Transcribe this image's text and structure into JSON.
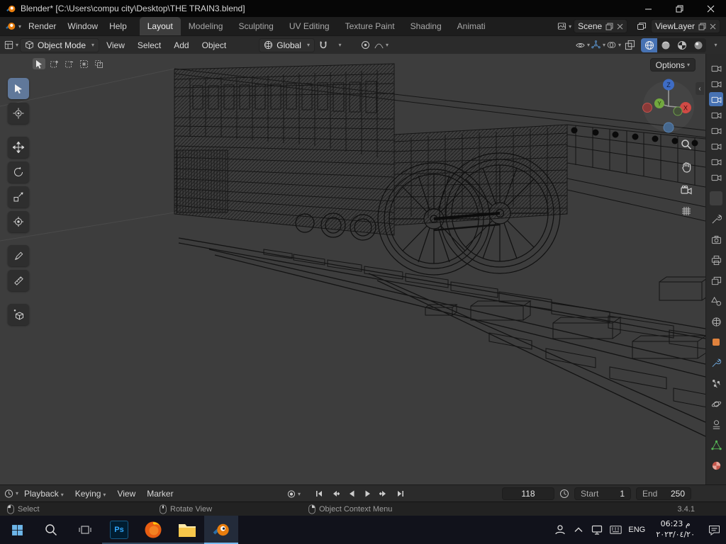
{
  "window": {
    "title": "Blender* [C:\\Users\\compu city\\Desktop\\THE TRAIN3.blend]"
  },
  "topbar": {
    "menus": [
      "Render",
      "Window",
      "Help"
    ],
    "workspaces": [
      "Layout",
      "Modeling",
      "Sculpting",
      "UV Editing",
      "Texture Paint",
      "Shading",
      "Animati"
    ],
    "scene": "Scene",
    "view_layer": "ViewLayer"
  },
  "viewport_header": {
    "mode": "Object Mode",
    "menus": [
      "View",
      "Select",
      "Add",
      "Object"
    ],
    "orientation": "Global"
  },
  "viewport": {
    "options": "Options",
    "axes": {
      "x": "X",
      "y": "Y",
      "z": "Z"
    }
  },
  "timeline": {
    "menus": [
      "Playback",
      "Keying",
      "View",
      "Marker"
    ],
    "current_frame": "118",
    "start_label": "Start",
    "start_value": "1",
    "end_label": "End",
    "end_value": "250"
  },
  "statusbar": {
    "hints": [
      "Select",
      "Rotate View",
      "Object Context Menu"
    ],
    "version": "3.4.1"
  },
  "taskbar": {
    "photoshop": "Ps",
    "language": "ENG",
    "time": "06:23 م",
    "date": "٢٠٢٣/٠٤/٢٠"
  },
  "colors": {
    "accent": "#4772b3",
    "axis_x": "#d04a45",
    "axis_y": "#72a83f",
    "axis_z": "#3e6cc4",
    "viewport_bg": "#3d3d3d",
    "object_tab": "#e0823d"
  }
}
